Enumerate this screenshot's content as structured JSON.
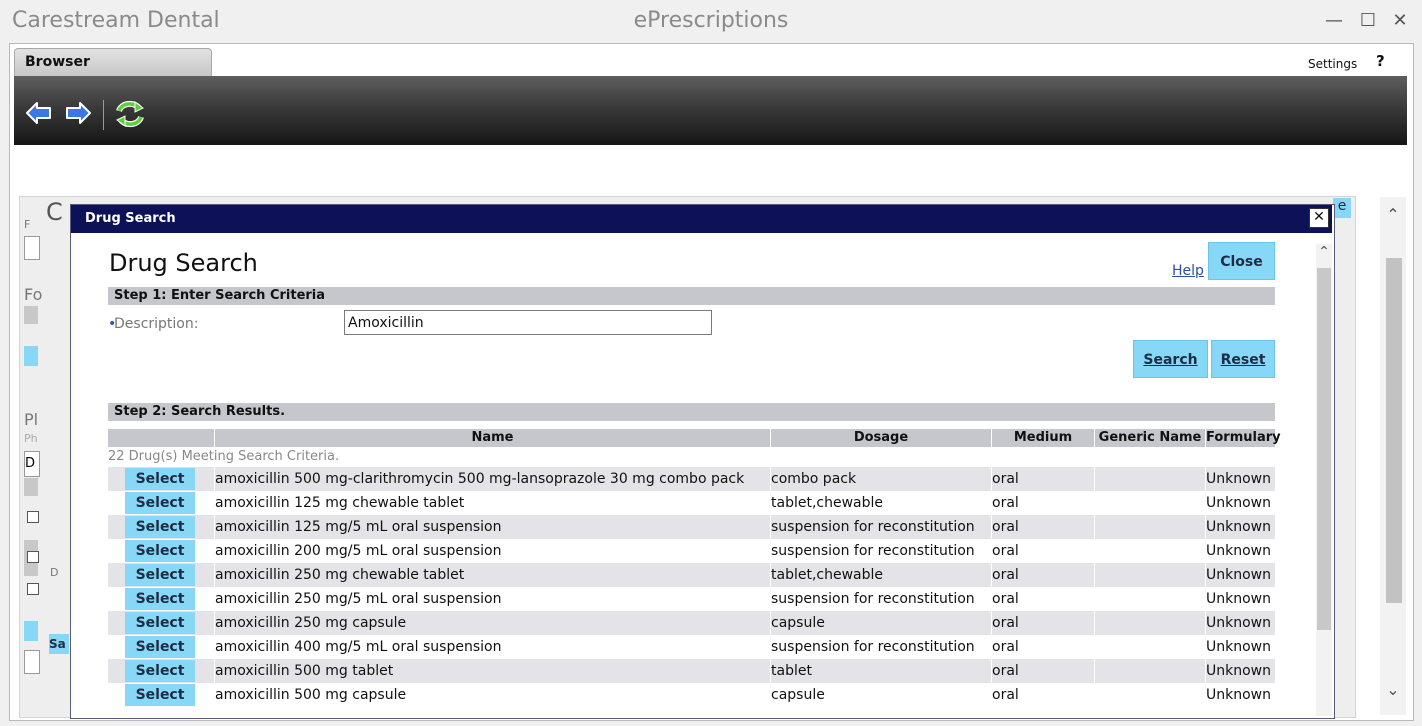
{
  "window": {
    "app_name": "Carestream Dental",
    "title": "ePrescriptions",
    "minimize_glyph": "—",
    "maximize_glyph": "☐",
    "close_glyph": "✕"
  },
  "browser": {
    "tab_label": "Browser",
    "settings_label": "Settings",
    "help_label": "?",
    "back_icon": "back-arrow-icon",
    "forward_icon": "forward-arrow-icon",
    "refresh_icon": "refresh-icon"
  },
  "underlay": {
    "heading_fragment": "C",
    "right_fragment": "e",
    "frag_f": "F",
    "frag_fo": "Fo",
    "frag_pl": "Pl",
    "frag_ph": "Ph",
    "frag_d": "D",
    "frag_dot_d": "D",
    "frag_sa": "Sa"
  },
  "modal": {
    "header_title": "Drug Search",
    "close_x": "✕",
    "heading": "Drug Search",
    "help_label": "Help",
    "close_label": "Close",
    "step1_label": "Step 1: Enter Search Criteria",
    "description_label": "Description:",
    "description_value": "Amoxicillin",
    "search_label": "Search",
    "reset_label": "Reset",
    "step2_label": "Step 2: Search Results.",
    "columns": [
      "Name",
      "Dosage",
      "Medium",
      "Generic Name",
      "Formulary"
    ],
    "count_text": "22 Drug(s) Meeting Search Criteria.",
    "select_label": "Select",
    "rows": [
      {
        "name": "amoxicillin 500 mg-clarithromycin 500 mg-lansoprazole 30 mg combo pack",
        "dosage": "combo pack",
        "medium": "oral",
        "generic": "",
        "formulary": "Unknown"
      },
      {
        "name": "amoxicillin 125 mg chewable tablet",
        "dosage": "tablet,chewable",
        "medium": "oral",
        "generic": "",
        "formulary": "Unknown"
      },
      {
        "name": "amoxicillin 125 mg/5 mL oral suspension",
        "dosage": "suspension for reconstitution",
        "medium": "oral",
        "generic": "",
        "formulary": "Unknown"
      },
      {
        "name": "amoxicillin 200 mg/5 mL oral suspension",
        "dosage": "suspension for reconstitution",
        "medium": "oral",
        "generic": "",
        "formulary": "Unknown"
      },
      {
        "name": "amoxicillin 250 mg chewable tablet",
        "dosage": "tablet,chewable",
        "medium": "oral",
        "generic": "",
        "formulary": "Unknown"
      },
      {
        "name": "amoxicillin 250 mg/5 mL oral suspension",
        "dosage": "suspension for reconstitution",
        "medium": "oral",
        "generic": "",
        "formulary": "Unknown"
      },
      {
        "name": "amoxicillin 250 mg capsule",
        "dosage": "capsule",
        "medium": "oral",
        "generic": "",
        "formulary": "Unknown"
      },
      {
        "name": "amoxicillin 400 mg/5 mL oral suspension",
        "dosage": "suspension for reconstitution",
        "medium": "oral",
        "generic": "",
        "formulary": "Unknown"
      },
      {
        "name": "amoxicillin 500 mg tablet",
        "dosage": "tablet",
        "medium": "oral",
        "generic": "",
        "formulary": "Unknown"
      },
      {
        "name": "amoxicillin 500 mg capsule",
        "dosage": "capsule",
        "medium": "oral",
        "generic": "",
        "formulary": "Unknown"
      }
    ]
  },
  "colors": {
    "accent_button": "#87d7f7",
    "modal_header": "#0d1157",
    "section_bar": "#c6c7cc",
    "row_alt": "#e4e4e8"
  }
}
